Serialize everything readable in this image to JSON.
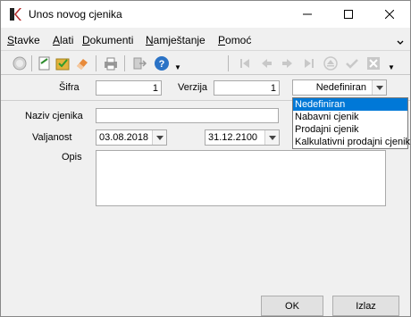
{
  "window": {
    "title": "Unos novog cjenika"
  },
  "menu": [
    {
      "label": "Stavke",
      "underline": "S",
      "rest": "tavke"
    },
    {
      "label": "Alati",
      "underline": "A",
      "rest": "lati"
    },
    {
      "label": "Dokumenti",
      "underline": "D",
      "rest": "okumenti"
    },
    {
      "label": "Namještanje",
      "underline": "N",
      "rest": "amještanje"
    },
    {
      "label": "Pomoć",
      "underline": "P",
      "rest": "omoć"
    }
  ],
  "form": {
    "sifra_label": "Šifra",
    "sifra_value": "1",
    "verzija_label": "Verzija",
    "verzija_value": "1",
    "tip_selected": "Nedefiniran",
    "naziv_label": "Naziv cjenika",
    "naziv_value": "",
    "valjanost_label": "Valjanost",
    "valid_from": "03.08.2018",
    "valid_to": "31.12.2100",
    "opis_label": "Opis",
    "opis_value": ""
  },
  "dropdown_options": [
    "Nedefiniran",
    "Nabavni cjenik",
    "Prodajni cjenik",
    "Kalkulativni prodajni cjenik"
  ],
  "buttons": {
    "ok": "OK",
    "izlaz": "Izlaz"
  },
  "colors": {
    "selection": "#0078d7",
    "help_blue": "#2b73c6"
  }
}
